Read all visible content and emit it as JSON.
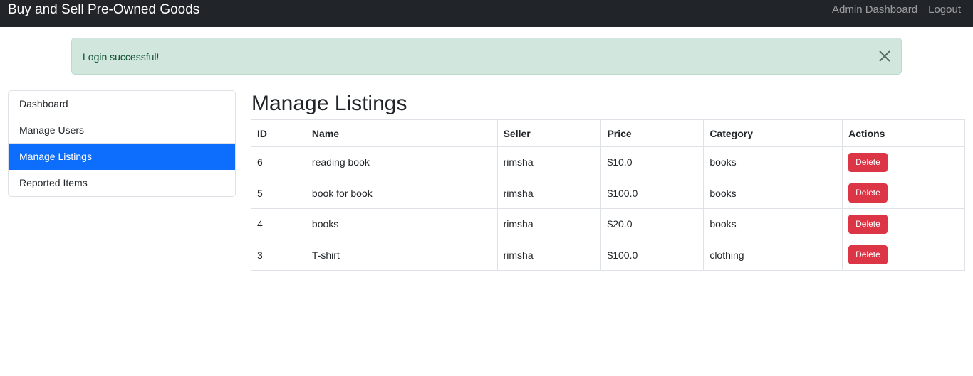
{
  "navbar": {
    "brand": "Buy and Sell Pre-Owned Goods",
    "links": [
      "Admin Dashboard",
      "Logout"
    ]
  },
  "alert": {
    "message": "Login successful!",
    "close_icon": "close-icon"
  },
  "sidebar": {
    "items": [
      {
        "label": "Dashboard",
        "active": false
      },
      {
        "label": "Manage Users",
        "active": false
      },
      {
        "label": "Manage Listings",
        "active": true
      },
      {
        "label": "Reported Items",
        "active": false
      }
    ]
  },
  "main": {
    "title": "Manage Listings",
    "table": {
      "headers": [
        "ID",
        "Name",
        "Seller",
        "Price",
        "Category",
        "Actions"
      ],
      "rows": [
        {
          "id": "6",
          "name": "reading book",
          "seller": "rimsha",
          "price": "$10.0",
          "category": "books",
          "action": "Delete"
        },
        {
          "id": "5",
          "name": "book for book",
          "seller": "rimsha",
          "price": "$100.0",
          "category": "books",
          "action": "Delete"
        },
        {
          "id": "4",
          "name": "books",
          "seller": "rimsha",
          "price": "$20.0",
          "category": "books",
          "action": "Delete"
        },
        {
          "id": "3",
          "name": "T-shirt",
          "seller": "rimsha",
          "price": "$100.0",
          "category": "clothing",
          "action": "Delete"
        }
      ]
    }
  },
  "colors": {
    "navbar_bg": "#212529",
    "alert_bg": "#d1e7dd",
    "active_item": "#0d6efd",
    "danger": "#dc3545"
  }
}
